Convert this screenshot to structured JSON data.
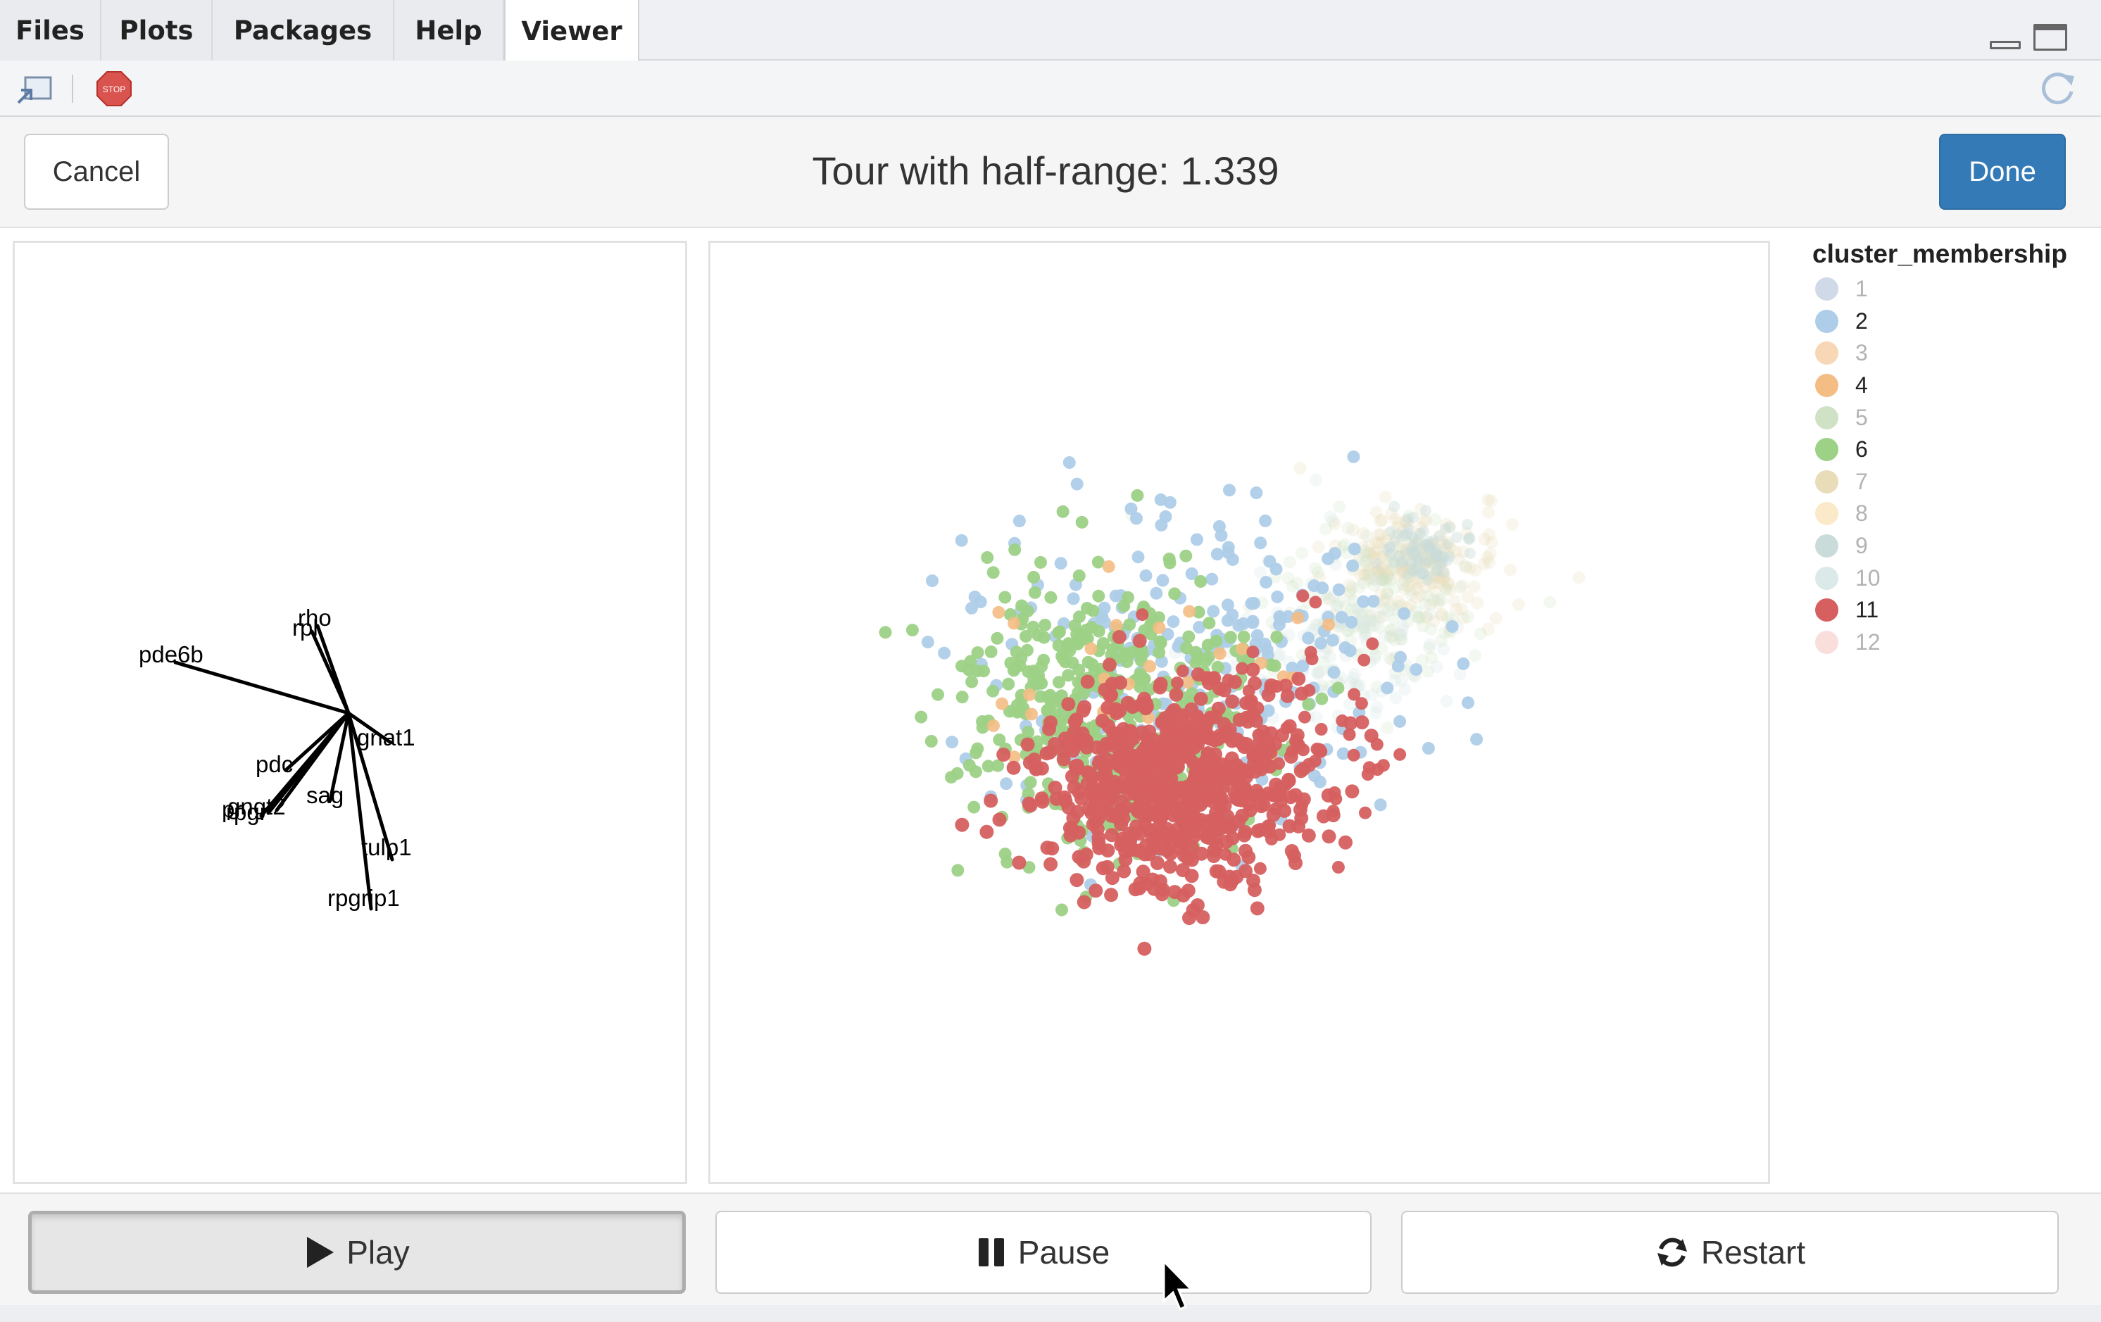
{
  "pane_tabs": [
    {
      "label": "Files",
      "active": false
    },
    {
      "label": "Plots",
      "active": false
    },
    {
      "label": "Packages",
      "active": false
    },
    {
      "label": "Help",
      "active": false
    },
    {
      "label": "Viewer",
      "active": true
    }
  ],
  "toolbar": {
    "export_icon": "export-icon",
    "stop_icon": "stop-icon",
    "stop_text": "STOP",
    "refresh_icon": "refresh-icon"
  },
  "header": {
    "cancel_label": "Cancel",
    "title": "Tour with half-range: 1.339",
    "done_label": "Done"
  },
  "axes_plot": {
    "labels": [
      "rho",
      "rpl",
      "pde6b",
      "gnat1",
      "pdc",
      "sag",
      "gngt2",
      "pr",
      "rpgr",
      "tulp1",
      "rpgrip1"
    ]
  },
  "legend": {
    "title": "cluster_membership",
    "items": [
      {
        "label": "1",
        "color": "#cfd9e8",
        "highlight": false
      },
      {
        "label": "2",
        "color": "#aecde8",
        "highlight": true
      },
      {
        "label": "3",
        "color": "#f7d7b6",
        "highlight": false
      },
      {
        "label": "4",
        "color": "#f4bd83",
        "highlight": true
      },
      {
        "label": "5",
        "color": "#cfe2c6",
        "highlight": false
      },
      {
        "label": "6",
        "color": "#9dd186",
        "highlight": true
      },
      {
        "label": "7",
        "color": "#e9dcb8",
        "highlight": false
      },
      {
        "label": "8",
        "color": "#fbeac9",
        "highlight": false
      },
      {
        "label": "9",
        "color": "#c9dcda",
        "highlight": false
      },
      {
        "label": "10",
        "color": "#dbe9e8",
        "highlight": false
      },
      {
        "label": "11",
        "color": "#d65f5f",
        "highlight": true
      },
      {
        "label": "12",
        "color": "#f9dedc",
        "highlight": false
      }
    ],
    "dim_text_color": "#b3b3b3",
    "bright_text_color": "#222222"
  },
  "controls": {
    "play_label": "Play",
    "pause_label": "Pause",
    "restart_label": "Restart"
  }
}
